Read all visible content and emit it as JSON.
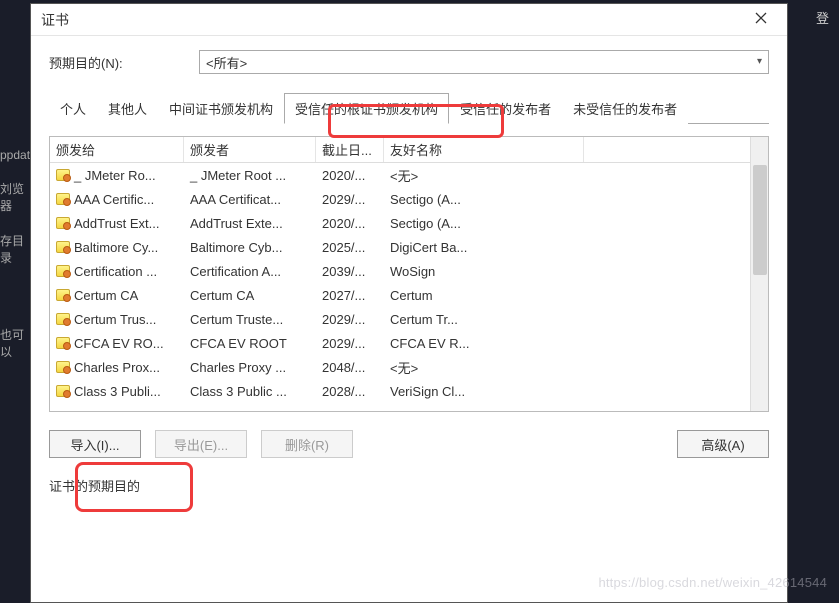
{
  "bg": {
    "login": "登",
    "side1": "ppdat",
    "side2": "刘览器",
    "side3": "存目录",
    "side4": "也可以"
  },
  "dialog": {
    "title": "证书",
    "purpose_label": "预期目的(N):",
    "purpose_value": "<所有>",
    "tabs": [
      "个人",
      "其他人",
      "中间证书颁发机构",
      "受信任的根证书颁发机构",
      "受信任的发布者",
      "未受信任的发布者"
    ],
    "active_tab_index": 3,
    "columns": [
      "颁发给",
      "颁发者",
      "截止日...",
      "友好名称"
    ],
    "rows": [
      {
        "to": "_ JMeter Ro...",
        "by": "_ JMeter Root ...",
        "exp": "2020/...",
        "name": "<无>"
      },
      {
        "to": "AAA Certific...",
        "by": "AAA Certificat...",
        "exp": "2029/...",
        "name": "Sectigo (A..."
      },
      {
        "to": "AddTrust Ext...",
        "by": "AddTrust Exte...",
        "exp": "2020/...",
        "name": "Sectigo (A..."
      },
      {
        "to": "Baltimore Cy...",
        "by": "Baltimore Cyb...",
        "exp": "2025/...",
        "name": "DigiCert Ba..."
      },
      {
        "to": "Certification ...",
        "by": "Certification A...",
        "exp": "2039/...",
        "name": "WoSign"
      },
      {
        "to": "Certum CA",
        "by": "Certum CA",
        "exp": "2027/...",
        "name": "Certum"
      },
      {
        "to": "Certum Trus...",
        "by": "Certum Truste...",
        "exp": "2029/...",
        "name": "Certum Tr..."
      },
      {
        "to": "CFCA EV RO...",
        "by": "CFCA EV ROOT",
        "exp": "2029/...",
        "name": "CFCA EV R..."
      },
      {
        "to": "Charles Prox...",
        "by": "Charles Proxy ...",
        "exp": "2048/...",
        "name": "<无>"
      },
      {
        "to": "Class 3 Publi...",
        "by": "Class 3 Public ...",
        "exp": "2028/...",
        "name": "VeriSign Cl..."
      }
    ],
    "buttons": {
      "import": "导入(I)...",
      "export": "导出(E)...",
      "delete": "删除(R)",
      "advanced": "高级(A)"
    },
    "section_label": "证书的预期目的"
  },
  "watermark": "https://blog.csdn.net/weixin_42614544"
}
